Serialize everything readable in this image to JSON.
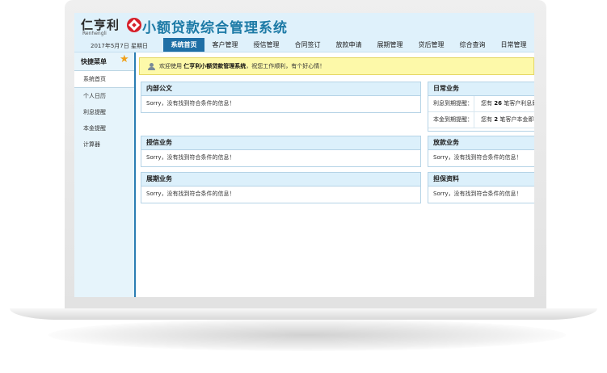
{
  "header": {
    "logo_cn": "仁亨利",
    "logo_en": "Renhengli",
    "title": "小额贷款综合管理系统",
    "date": "2017年5月7日 星期日"
  },
  "nav": [
    {
      "label": "系统首页",
      "active": true
    },
    {
      "label": "客户管理"
    },
    {
      "label": "授信管理"
    },
    {
      "label": "合同签订"
    },
    {
      "label": "放款申请"
    },
    {
      "label": "展期管理"
    },
    {
      "label": "贷后管理"
    },
    {
      "label": "综合查询"
    },
    {
      "label": "日常管理"
    }
  ],
  "sidebar": {
    "title": "快捷菜单",
    "items": [
      {
        "label": "系统首页",
        "active": true
      },
      {
        "label": "个人日历"
      },
      {
        "label": "利息提醒"
      },
      {
        "label": "本金提醒"
      },
      {
        "label": "计算器"
      }
    ]
  },
  "welcome": {
    "prefix": "欢迎使用",
    "system": "仁亨利小额贷款管理系统",
    "suffix": "，祝您工作顺利，有个好心情！"
  },
  "panels": {
    "notice": {
      "title": "内部公文",
      "body": "Sorry，没有找到符合条件的信息！"
    },
    "credit": {
      "title": "授信业务",
      "body": "Sorry，没有找到符合条件的信息！"
    },
    "extension": {
      "title": "展期业务",
      "body": "Sorry，没有找到符合条件的信息！"
    },
    "daily": {
      "title": "日常业务",
      "rows": [
        {
          "key": "利息到期提醒：",
          "pre": "您有",
          "count": "26",
          "post": "笔客户利息即"
        },
        {
          "key": "本金到期提醒：",
          "pre": "您有",
          "count": "2",
          "post": "笔客户本金即将"
        }
      ]
    },
    "loan": {
      "title": "放款业务",
      "body": "Sorry，没有找到符合条件的信息！"
    },
    "guarantee": {
      "title": "担保资料",
      "body": "Sorry，没有找到符合条件的信息！"
    }
  },
  "colors": {
    "accent": "#1e6fa6",
    "header_bg": "#dff1fb",
    "welcome_bg": "#fdf9a9",
    "star": "#f0a018",
    "logo_red": "#d6202a"
  }
}
